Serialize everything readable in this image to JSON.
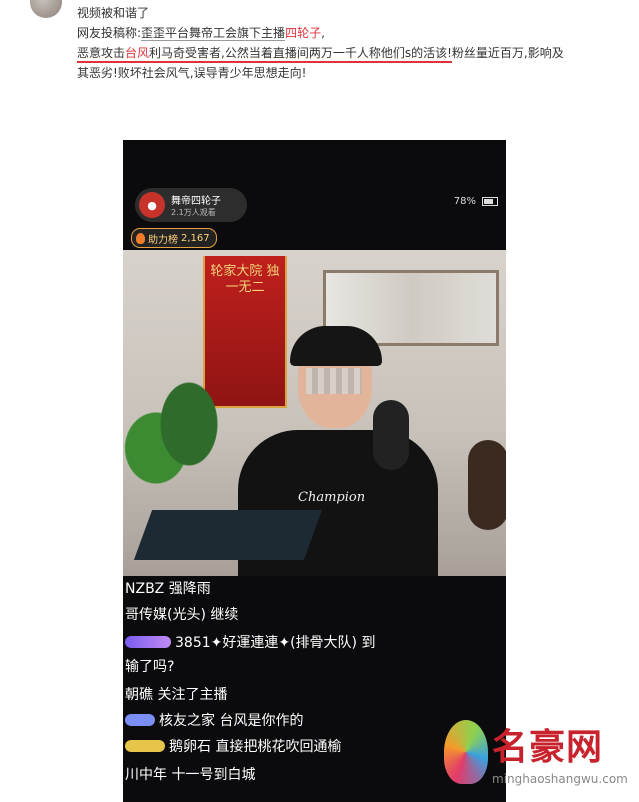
{
  "post": {
    "line1": "视频被和谐了",
    "line2_prefix": "网友投稿称:",
    "line2_org": "歪歪平台舞帝工会旗下主播",
    "line2_streamer": "四轮子",
    "line2_suffix": ",",
    "line3_a": "恶意攻击",
    "line3_victim": "台风",
    "line3_b": "利马奇受害者,公然当着直播间两万一千人称他们s的活该!",
    "line3_c": "粉丝量近百万,影响及",
    "line4": "其恶劣!败坏社会风气,误导青少年思想走向!"
  },
  "stream": {
    "streamer_name": "舞帝四轮子",
    "viewers": "2.1万人观看",
    "power_label": "助力榜",
    "power_value": "2,167",
    "battery": "78%",
    "banner_text": "轮家大院 独一无二",
    "shirt_brand": "Champion"
  },
  "chat": [
    {
      "text": "NZBZ 强降雨"
    },
    {
      "text": "哥传媒(光头) 继续"
    },
    {
      "text": "3851✦好運連連✦(排骨大队) 到"
    },
    {
      "text": "输了吗?"
    },
    {
      "text": "朝礁 关注了主播"
    },
    {
      "text": "核友之家 台风是你作的"
    },
    {
      "text": "鹅卵石 直接把桃花吹回通榆"
    },
    {
      "text": "川中年 十一号到白城"
    }
  ],
  "watermark": {
    "title": "名豪网",
    "url": "minghaoshangwu.com"
  },
  "colors": {
    "highlight": "#e0323a",
    "chat_text": "#ffffff"
  }
}
